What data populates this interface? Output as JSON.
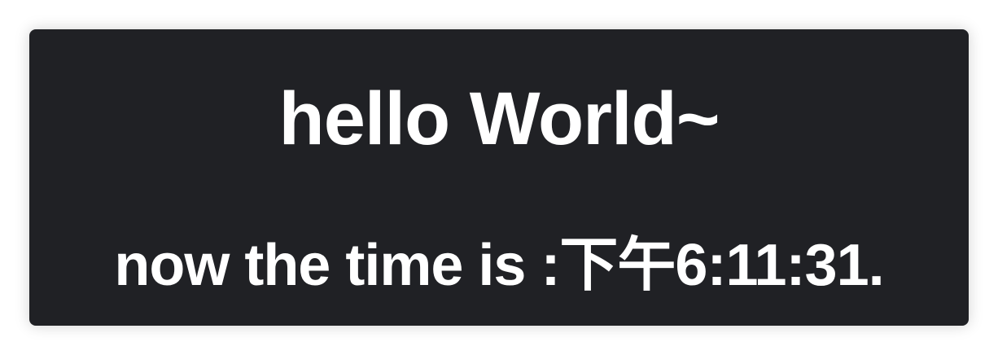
{
  "greeting": "hello World~",
  "time_line": "now the time is :下午6:11:31.",
  "colors": {
    "panel_background": "#202125",
    "text": "#ffffff",
    "page_background": "#ffffff"
  }
}
